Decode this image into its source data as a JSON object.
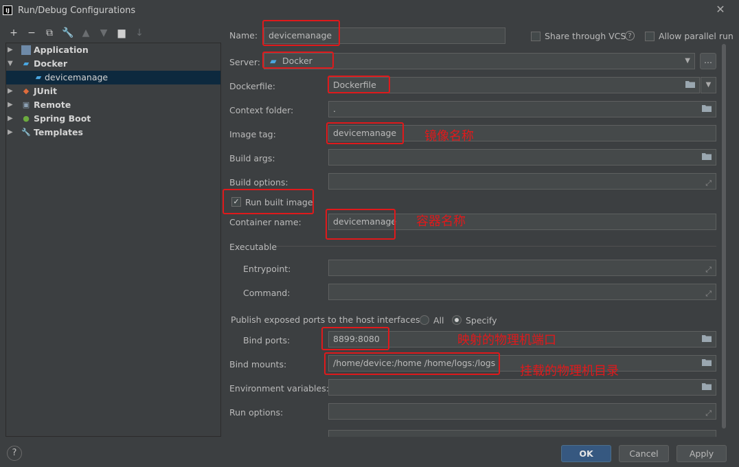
{
  "window": {
    "title": "Run/Debug Configurations",
    "app_icon": "IJ"
  },
  "toolbar": [
    "add-icon",
    "remove-icon",
    "copy-icon",
    "wrench-icon",
    "move-up-icon",
    "move-down-icon",
    "new-folder-icon",
    "sort-icon"
  ],
  "tree": [
    {
      "label": "Application",
      "icon": "application-icon",
      "expanded": false
    },
    {
      "label": "Docker",
      "icon": "docker-icon",
      "expanded": true
    },
    {
      "label": "devicemanage",
      "icon": "docker-icon",
      "child": true,
      "selected": true
    },
    {
      "label": "JUnit",
      "icon": "junit-icon",
      "expanded": false
    },
    {
      "label": "Remote",
      "icon": "remote-icon",
      "expanded": false
    },
    {
      "label": "Spring Boot",
      "icon": "spring-boot-icon",
      "expanded": false
    },
    {
      "label": "Templates",
      "icon": "wrench-icon",
      "expanded": false
    }
  ],
  "form": {
    "name_label": "Name:",
    "name_value": "devicemanage",
    "share_label": "Share through VCS",
    "allow_parallel_label": "Allow parallel run",
    "server_label": "Server:",
    "server_value": "Docker",
    "more_button": "...",
    "dockerfile_label": "Dockerfile:",
    "dockerfile_value": "Dockerfile",
    "context_label": "Context folder:",
    "context_value": ".",
    "image_tag_label": "Image tag:",
    "image_tag_value": "devicemanage",
    "build_args_label": "Build args:",
    "build_options_label": "Build options:",
    "run_built_label": "Run built image",
    "container_name_label": "Container name:",
    "container_name_value": "devicemanage",
    "executable_label": "Executable",
    "entrypoint_label": "Entrypoint:",
    "command_label": "Command:",
    "publish_label": "Publish exposed ports to the host interfaces:",
    "all_label": "All",
    "specify_label": "Specify",
    "bind_ports_label": "Bind ports:",
    "bind_ports_value": "8899:8080",
    "bind_mounts_label": "Bind mounts:",
    "bind_mounts_value": "/home/device:/home  /home/logs:/logs",
    "env_label": "Environment variables:",
    "run_options_label": "Run options:"
  },
  "annotations": {
    "image_name": "镜像名称",
    "container_name": "容器名称",
    "port_mapping": "映射的物理机端口",
    "mount_dir": "挂载的物理机目录"
  },
  "buttons": {
    "help": "?",
    "ok": "OK",
    "cancel": "Cancel",
    "apply": "Apply"
  },
  "colors": {
    "background": "#3c3f41",
    "field": "#45494a",
    "selection": "#0d293e",
    "annotation_red": "#e0191b",
    "primary": "#365880"
  }
}
